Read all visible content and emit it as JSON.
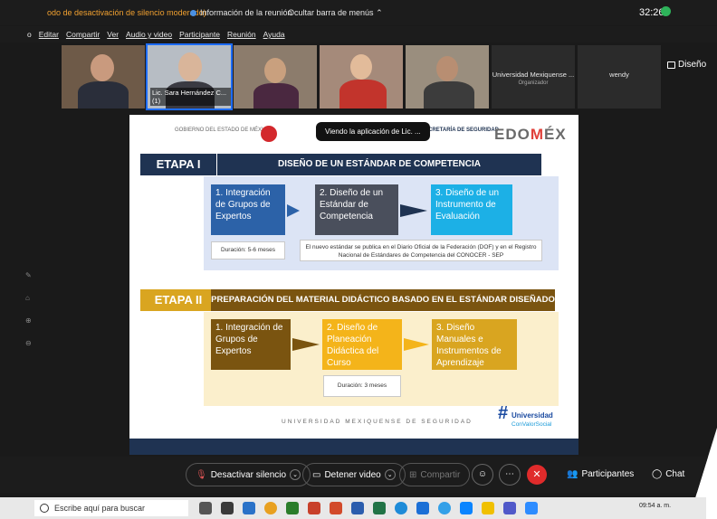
{
  "topbar": {
    "warning": "odo de desactivación de silencio moderado)",
    "meeting_info": "Información de la reunión",
    "hide_menus": "Ocultar barra de menús",
    "timer": "32:26"
  },
  "menubar": {
    "items": [
      "o",
      "Editar",
      "Compartir",
      "Ver",
      "Audio y video",
      "Participante",
      "Reunión",
      "Ayuda"
    ]
  },
  "participants": {
    "selected_label": "Lic. Sara Hernández C... (1)",
    "organizer_name": "Universidad Mexiquense ...",
    "organizer_role": "Organizador",
    "guest_name": "wendy"
  },
  "view_button": "Diseño",
  "slide": {
    "tooltip": "Viendo la aplicación de Lic. ...",
    "logo_gob": "GOBIERNO DEL ESTADO DE MÉXICO",
    "logo_sec": "SECRETARÍA DE SEGURIDAD",
    "logo_edomex_a": "EDO",
    "logo_edomex_b": "M",
    "logo_edomex_c": "ÉX",
    "etapa1": "ETAPA I",
    "etapa1_title": "DISEÑO DE UN ESTÁNDAR DE COMPETENCIA",
    "etapa1_steps": [
      "1. Integración de Grupos de Expertos",
      "2. Diseño de un Estándar de Competencia",
      "3. Diseño de un Instrumento de Evaluación"
    ],
    "etapa1_duration": "Duración: 5-6 meses",
    "etapa1_note": "El nuevo estándar se publica en el Diario Oficial de la Federación (DOF) y en el Registro Nacional de Estándares de Competencia del CONOCER - SEP",
    "etapa2": "ETAPA II",
    "etapa2_title": "PREPARACIÓN DEL MATERIAL DIDÁCTICO BASADO EN EL ESTÁNDAR DISEÑADO",
    "etapa2_steps": [
      "1. Integración de Grupos de Expertos",
      "2. Diseño de Planeación Didáctica del Curso",
      "3. Diseño Manuales e Instrumentos de Aprendizaje"
    ],
    "etapa2_duration": "Duración: 3 meses",
    "footer": "UNIVERSIDAD MEXIQUENSE DE SEGURIDAD",
    "brand_hash": "#",
    "brand_line1": "Universidad",
    "brand_line2": "ConValorSocial"
  },
  "toolbar": {
    "unmute": "Desactivar silencio",
    "stop_video": "Detener video",
    "share": "Compartir",
    "participants": "Participantes",
    "chat": "Chat"
  },
  "taskbar": {
    "search_placeholder": "Escribe aquí para buscar",
    "clock": "09:54 a. m."
  },
  "colors": {
    "navy": "#1f3352",
    "gold": "#d9a520",
    "brown": "#7a5410",
    "end_red": "#e02b2b",
    "selected_blue": "#1d6cff"
  }
}
